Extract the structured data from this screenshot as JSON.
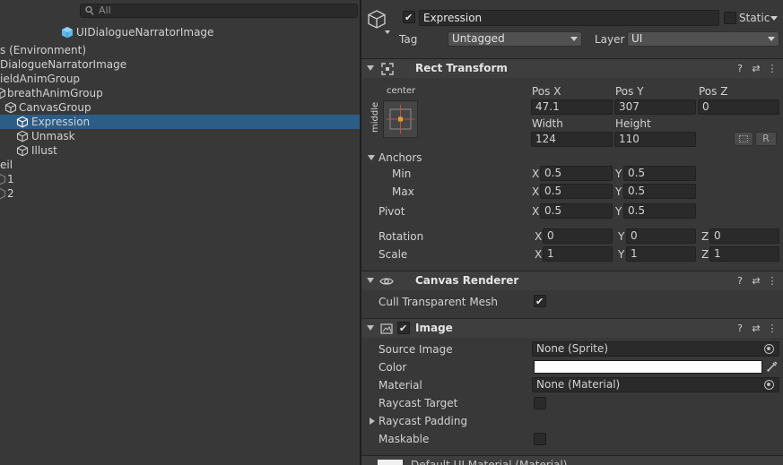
{
  "hierarchy": {
    "search_placeholder": "All",
    "scene_title": "UIDialogueNarratorImage",
    "rows": [
      {
        "label": "s (Environment)"
      },
      {
        "label": "DialogueNarratorImage"
      },
      {
        "label": "ieldAnimGroup"
      },
      {
        "label": "breathAnimGroup"
      },
      {
        "label": "CanvasGroup"
      },
      {
        "label": "Expression"
      },
      {
        "label": "Unmask"
      },
      {
        "label": "Illust"
      },
      {
        "label": "eil"
      },
      {
        "label": "1"
      },
      {
        "label": "2"
      }
    ]
  },
  "inspector": {
    "object_name": "Expression",
    "static_label": "Static",
    "tag_label": "Tag",
    "tag_value": "Untagged",
    "layer_label": "Layer",
    "layer_value": "UI",
    "rect_transform": {
      "title": "Rect Transform",
      "anchor_h": "center",
      "anchor_v": "middle",
      "pos_x_label": "Pos X",
      "pos_y_label": "Pos Y",
      "pos_z_label": "Pos Z",
      "pos_x": "47.1",
      "pos_y": "307",
      "pos_z": "0",
      "width_label": "Width",
      "height_label": "Height",
      "width": "124",
      "height": "110",
      "r_button": "R",
      "anchors_label": "Anchors",
      "min_label": "Min",
      "max_label": "Max",
      "min_x": "0.5",
      "min_y": "0.5",
      "max_x": "0.5",
      "max_y": "0.5",
      "pivot_label": "Pivot",
      "pivot_x": "0.5",
      "pivot_y": "0.5",
      "rotation_label": "Rotation",
      "rot_x": "0",
      "rot_y": "0",
      "rot_z": "0",
      "scale_label": "Scale",
      "scale_x": "1",
      "scale_y": "1",
      "scale_z": "1",
      "x": "X",
      "y": "Y",
      "z": "Z"
    },
    "canvas_renderer": {
      "title": "Canvas Renderer",
      "cull_label": "Cull Transparent Mesh"
    },
    "image": {
      "title": "Image",
      "source_image_label": "Source Image",
      "source_image_value": "None (Sprite)",
      "color_label": "Color",
      "color_value": "#ffffff",
      "material_label": "Material",
      "material_value": "None (Material)",
      "raycast_target_label": "Raycast Target",
      "raycast_padding_label": "Raycast Padding",
      "maskable_label": "Maskable"
    },
    "footer_material": "Default UI Material (Material)"
  },
  "colors": {
    "selection": "#2c5d87",
    "cube_blue": "#5fb8e8",
    "panel": "#383838",
    "field": "#2a2a2a"
  }
}
